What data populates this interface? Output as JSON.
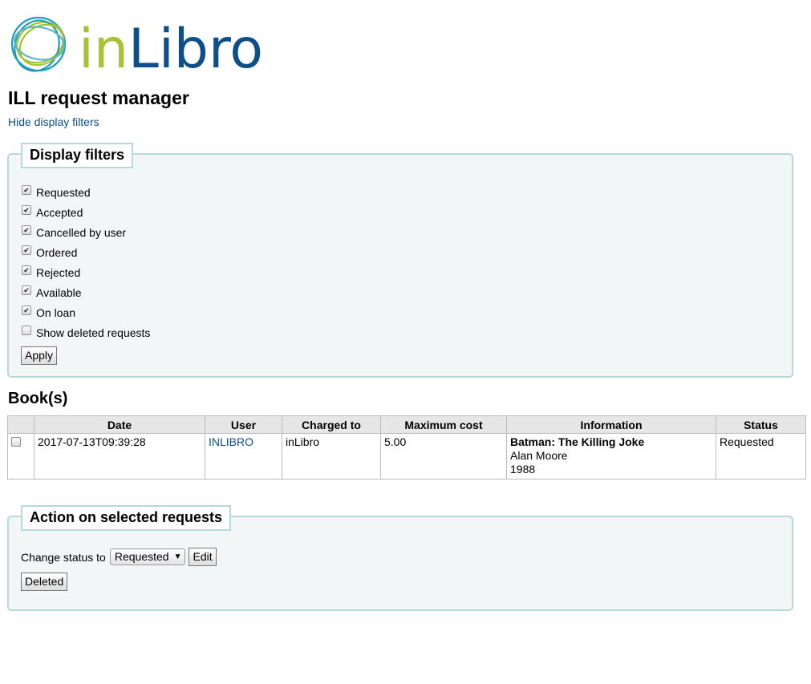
{
  "logo": {
    "text": "inLibro"
  },
  "page": {
    "title": "ILL request manager",
    "toggle_filters_link": "Hide display filters"
  },
  "filters": {
    "legend": "Display filters",
    "items": [
      {
        "label": "Requested",
        "checked": true
      },
      {
        "label": "Accepted",
        "checked": true
      },
      {
        "label": "Cancelled by user",
        "checked": true
      },
      {
        "label": "Ordered",
        "checked": true
      },
      {
        "label": "Rejected",
        "checked": true
      },
      {
        "label": "Available",
        "checked": true
      },
      {
        "label": "On loan",
        "checked": true
      },
      {
        "label": "Show deleted requests",
        "checked": false
      }
    ],
    "apply_label": "Apply"
  },
  "books": {
    "heading": "Book(s)",
    "columns": [
      "",
      "Date",
      "User",
      "Charged to",
      "Maximum cost",
      "Information",
      "Status"
    ],
    "rows": [
      {
        "selected": false,
        "date": "2017-07-13T09:39:28",
        "user": "INLIBRO",
        "charged_to": "inLibro",
        "maximum_cost": "5.00",
        "info_title": "Batman: The Killing Joke",
        "info_author": "Alan Moore",
        "info_year": "1988",
        "status": "Requested"
      }
    ]
  },
  "actions": {
    "legend": "Action on selected requests",
    "change_status_label": "Change status to",
    "status_selected": "Requested",
    "edit_label": "Edit",
    "deleted_label": "Deleted"
  },
  "colors": {
    "logo_ring_blue": "#1f9dbf",
    "logo_ring_green": "#a5c332",
    "logo_in": "#a5c332",
    "logo_libro": "#0d4f8b",
    "link": "#0b4f8c",
    "panel_border": "#b9d9d6",
    "panel_background": "#f3f6f7"
  }
}
